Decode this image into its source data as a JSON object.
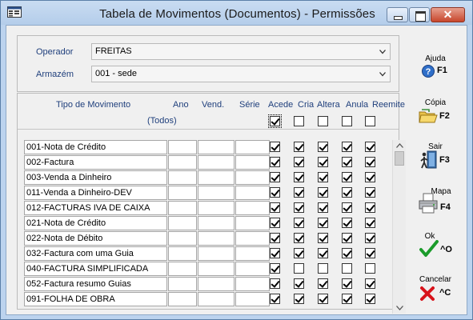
{
  "window": {
    "title": "Tabela de Movimentos (Documentos) - Permissões",
    "close_label": "✕"
  },
  "filters": {
    "operador_label": "Operador",
    "operador_value": "FREITAS",
    "armazem_label": "Armazém",
    "armazem_value": "001 - sede"
  },
  "grid": {
    "headers": {
      "tipo": "Tipo de Movimento",
      "ano": "Ano",
      "vend": "Vend.",
      "serie": "Série",
      "acede": "Acede",
      "cria": "Cria",
      "altera": "Altera",
      "anula": "Anula",
      "reemite": "Reemite"
    },
    "todos_label": "(Todos)",
    "todos": {
      "acede": true,
      "cria": false,
      "altera": false,
      "anula": false,
      "reemite": false
    },
    "rows": [
      {
        "tipo": "001-Nota de Crédito",
        "ano": "",
        "vend": "",
        "serie": "",
        "acede": true,
        "cria": true,
        "altera": true,
        "anula": true,
        "reemite": true
      },
      {
        "tipo": "002-Factura",
        "ano": "",
        "vend": "",
        "serie": "",
        "acede": true,
        "cria": true,
        "altera": true,
        "anula": true,
        "reemite": true
      },
      {
        "tipo": "003-Venda a Dinheiro",
        "ano": "",
        "vend": "",
        "serie": "",
        "acede": true,
        "cria": true,
        "altera": true,
        "anula": true,
        "reemite": true
      },
      {
        "tipo": "011-Venda a Dinheiro-DEV",
        "ano": "",
        "vend": "",
        "serie": "",
        "acede": true,
        "cria": true,
        "altera": true,
        "anula": true,
        "reemite": true
      },
      {
        "tipo": "012-FACTURAS IVA DE CAIXA",
        "ano": "",
        "vend": "",
        "serie": "",
        "acede": true,
        "cria": true,
        "altera": true,
        "anula": true,
        "reemite": true
      },
      {
        "tipo": "021-Nota de Crédito",
        "ano": "",
        "vend": "",
        "serie": "",
        "acede": true,
        "cria": true,
        "altera": true,
        "anula": true,
        "reemite": true
      },
      {
        "tipo": "022-Nota de Débito",
        "ano": "",
        "vend": "",
        "serie": "",
        "acede": true,
        "cria": true,
        "altera": true,
        "anula": true,
        "reemite": true
      },
      {
        "tipo": "032-Factura com uma Guia",
        "ano": "",
        "vend": "",
        "serie": "",
        "acede": true,
        "cria": true,
        "altera": true,
        "anula": true,
        "reemite": true
      },
      {
        "tipo": "040-FACTURA SIMPLIFICADA",
        "ano": "",
        "vend": "",
        "serie": "",
        "acede": true,
        "cria": false,
        "altera": false,
        "anula": false,
        "reemite": false
      },
      {
        "tipo": "052-Factura resumo Guias",
        "ano": "",
        "vend": "",
        "serie": "",
        "acede": true,
        "cria": true,
        "altera": true,
        "anula": true,
        "reemite": true
      },
      {
        "tipo": "091-FOLHA DE OBRA",
        "ano": "",
        "vend": "",
        "serie": "",
        "acede": true,
        "cria": true,
        "altera": true,
        "anula": true,
        "reemite": true
      }
    ]
  },
  "sidebar": {
    "ajuda": {
      "label": "Ajuda",
      "key": "F1",
      "icon": "help-icon"
    },
    "copia": {
      "label": "Cópia",
      "key": "F2",
      "icon": "folder-copy-icon"
    },
    "sair": {
      "label": "Sair",
      "key": "F3",
      "icon": "exit-door-icon"
    },
    "mapa": {
      "label": "Mapa",
      "key": "F4",
      "icon": "printer-icon"
    },
    "ok": {
      "label": "Ok",
      "key": "^O",
      "icon": "checkmark-icon"
    },
    "cancelar": {
      "label": "Cancelar",
      "key": "^C",
      "icon": "red-x-icon"
    }
  },
  "colors": {
    "label_blue": "#1f3f7c",
    "ok_green": "#1a9b2a",
    "cancel_red": "#d8131b"
  }
}
